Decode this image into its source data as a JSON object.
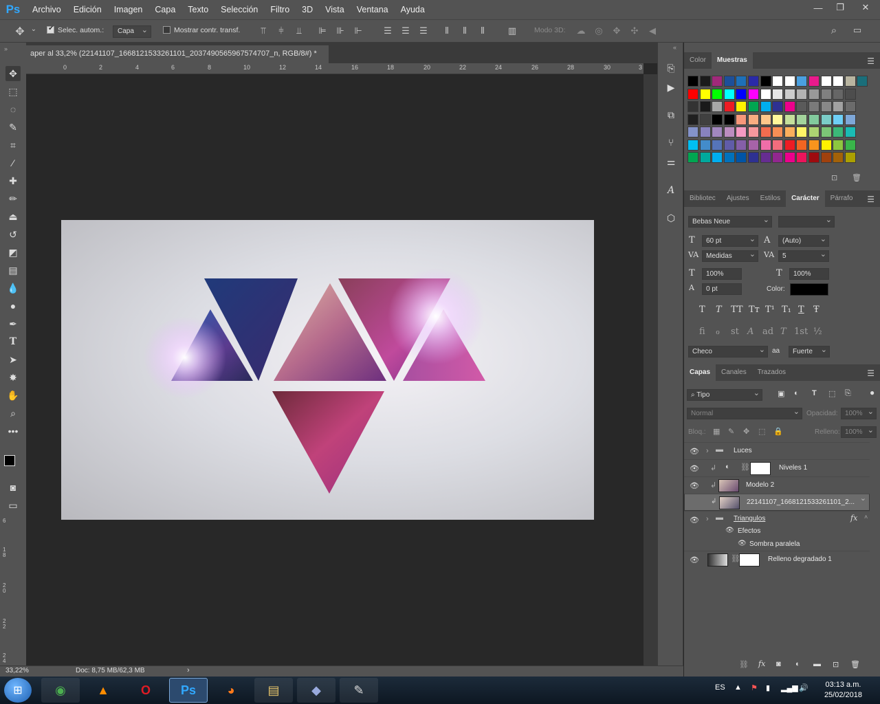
{
  "app": {
    "logo": "Ps",
    "menus": [
      "Archivo",
      "Edición",
      "Imagen",
      "Capa",
      "Texto",
      "Selección",
      "Filtro",
      "3D",
      "Vista",
      "Ventana",
      "Ayuda"
    ],
    "win_min": "—",
    "win_restore": "❐",
    "win_close": "✕"
  },
  "options": {
    "auto_select_label": "Selec. autom.:",
    "auto_select_value": "Capa",
    "show_transform_label": "Mostrar contr. transf.",
    "mode3d_label": "Modo 3D:"
  },
  "document": {
    "tab_title": "aper al 33,2% (22141107_1668121533261101_2037490565967574707_n, RGB/8#) *",
    "tab_close": "✕",
    "zoom": "33,22%",
    "doc_size": "Doc: 8,75 MB/62,3 MB",
    "status_arrow": "›"
  },
  "ruler": {
    "h_ticks": [
      "0",
      "2",
      "4",
      "6",
      "8",
      "10",
      "12",
      "14",
      "16",
      "18",
      "20",
      "22",
      "24",
      "26",
      "28",
      "30",
      "3"
    ],
    "v_ticks": [
      "6",
      "1\n8",
      "2\n0",
      "2\n2",
      "2\n4"
    ]
  },
  "panels": {
    "swatch_tabs": [
      "Color",
      "Muestras"
    ],
    "swatch_colors": [
      "#000000",
      "#1b1b1b",
      "#a0297a",
      "#1d4f99",
      "#1e70b8",
      "#2a2aa8",
      "#000000",
      "#ffffff",
      "#ffffff",
      "#4aa0e0",
      "#e81a8c",
      "#ffffff",
      "#ffffff",
      "#b8b4a0",
      "#1a6e7a",
      "#333333",
      "#ff0000",
      "#ffff00",
      "#00ff00",
      "#00ffff",
      "#0000ff",
      "#ff00ff",
      "#ffffff",
      "#e6e6e6",
      "#cccccc",
      "#b3b3b3",
      "#999999",
      "#808080",
      "#666666",
      "#4d4d4d",
      "#333333",
      "#1a1a1a",
      "#a8a8a8",
      "#ed1c24",
      "#fff200",
      "#00a651",
      "#00aeef",
      "#2e3192",
      "#ec008c",
      "#5a5a5a",
      "#7a7a7a",
      "#888888",
      "#a1a1a1",
      "#6b6b6b",
      "#202020",
      "#404040",
      "#000000",
      "#000000",
      "#f7977a",
      "#f9ad81",
      "#fdc68a",
      "#fff79a",
      "#c4df9b",
      "#a3d39c",
      "#82ca9d",
      "#7bcdc8",
      "#6ecff6",
      "#7ea7d8",
      "#8493ca",
      "#8882be",
      "#a187be",
      "#bc8dbf",
      "#f49ac2",
      "#f6989d",
      "#f26c4f",
      "#f68e55",
      "#fbaf5c",
      "#fff467",
      "#acd372",
      "#7cc576",
      "#3bb878",
      "#1abbb4",
      "#00bff3",
      "#438ccb",
      "#5574b9",
      "#605ca8",
      "#855fa8",
      "#a763a8",
      "#f06ea9",
      "#f26d7d",
      "#ed1c24",
      "#f26522",
      "#f7941d",
      "#fff200",
      "#8dc63f",
      "#39b54a",
      "#00a651",
      "#00a99d",
      "#00aeef",
      "#0072bc",
      "#0054a6",
      "#2e3192",
      "#662d91",
      "#92278f",
      "#ec008c",
      "#ed145b",
      "#9e0b0f",
      "#a0410d",
      "#a36209",
      "#aba000"
    ],
    "char_tabs": [
      "Bibliotec",
      "Ajustes",
      "Estilos",
      "Carácter",
      "Párrafo"
    ],
    "font_family": "Bebas Neue",
    "font_size": "60 pt",
    "leading": "(Auto)",
    "kerning": "Medidas",
    "tracking": "5",
    "v_scale": "100%",
    "h_scale": "100%",
    "baseline": "0 pt",
    "color_label": "Color:",
    "language": "Checo",
    "aa_label": "aa",
    "aa_method": "Fuerte",
    "style_glyphs": [
      "T",
      "T",
      "TT",
      "Tт",
      "T¹",
      "T₁",
      "T",
      "Ŧ"
    ],
    "ot_glyphs": [
      "fi",
      "ℴ",
      "st",
      "A",
      "ad",
      "T",
      "1st",
      "½"
    ],
    "layer_tabs": [
      "Capas",
      "Canales",
      "Trazados"
    ],
    "filter_kind": "Tipo",
    "blend_mode": "Normal",
    "opacity_label": "Opacidad:",
    "opacity_value": "100%",
    "lock_label": "Bloq.:",
    "fill_label": "Relleno:",
    "fill_value": "100%",
    "layers": [
      {
        "name": "Luces"
      },
      {
        "name": "Niveles 1"
      },
      {
        "name": "Modelo 2"
      },
      {
        "name": "22141107_1668121533261101_2..."
      },
      {
        "name": "Triangulos"
      },
      {
        "name": "Efectos"
      },
      {
        "name": "Sombra paralela"
      },
      {
        "name": "Relleno degradado 1"
      }
    ],
    "fx_label": "fx"
  },
  "taskbar": {
    "language": "ES",
    "time": "03:13 a.m.",
    "date": "25/02/2018"
  },
  "colors": {
    "accent": "#31a8ff",
    "panel": "#535353",
    "dark": "#282828"
  }
}
